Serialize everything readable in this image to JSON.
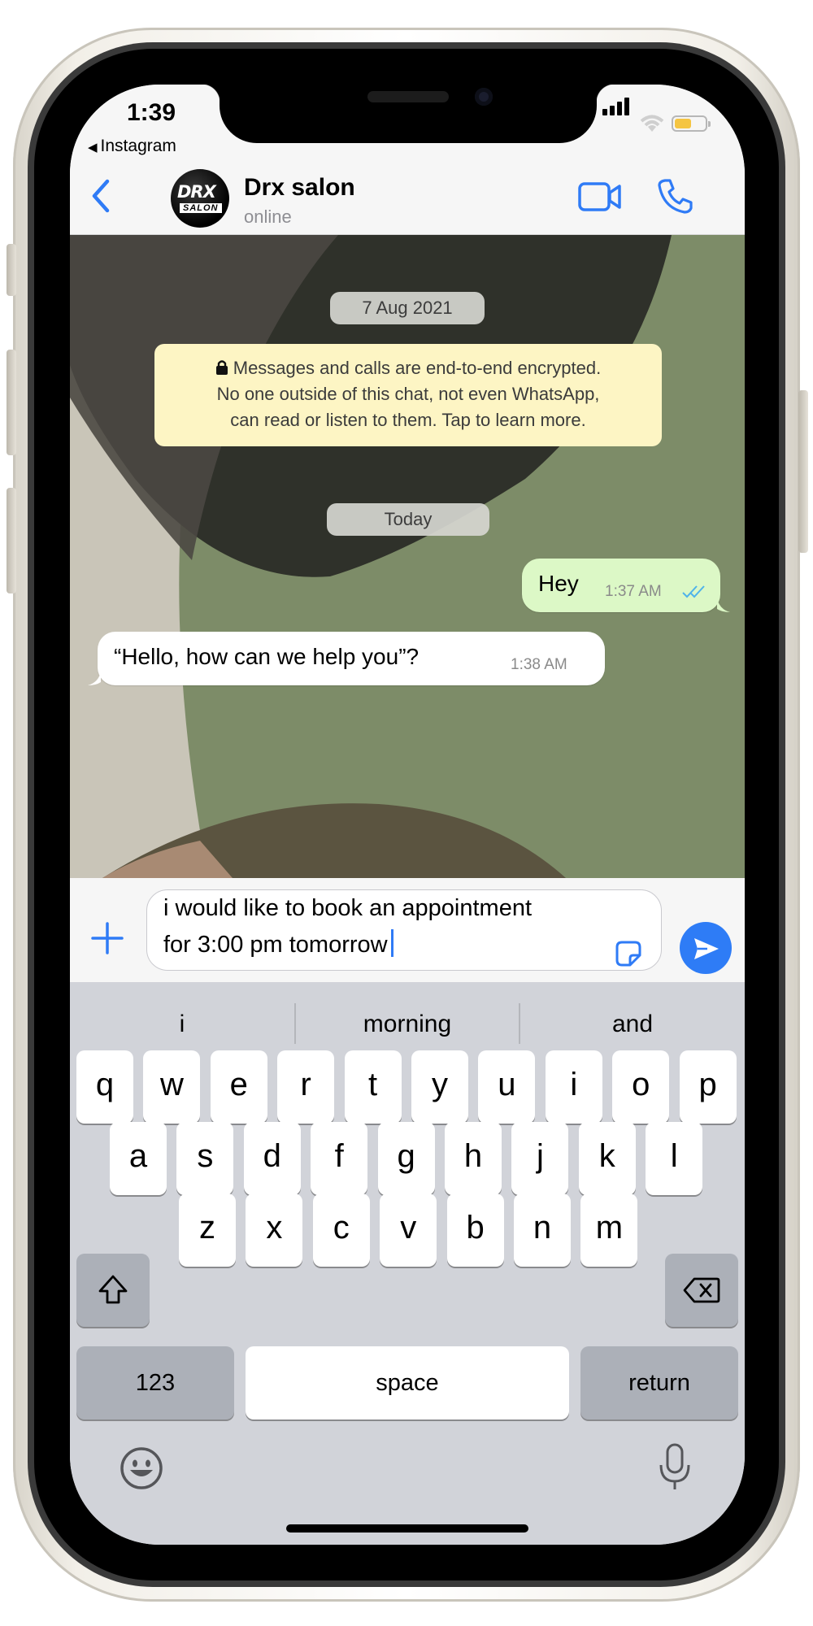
{
  "status_bar": {
    "time": "1:39",
    "back_app": "Instagram",
    "back_arrow": "◀"
  },
  "header": {
    "back_icon": "chevron-left-icon",
    "contact_name": "Drx salon",
    "contact_status": "online",
    "avatar_text_top": "DRX",
    "avatar_text_bottom": "SALON",
    "video_icon": "video-camera-icon",
    "call_icon": "phone-icon",
    "accent_color": "#2f7bf6"
  },
  "chat": {
    "date_pill_1": "7 Aug 2021",
    "encryption_notice": {
      "line1": "Messages and calls are end-to-end encrypted.",
      "line2": "No one outside of this chat, not even WhatsApp,",
      "line3": "can read or listen to them. Tap to learn more."
    },
    "date_pill_2": "Today",
    "messages": [
      {
        "direction": "outgoing",
        "text": "Hey",
        "time": "1:37 AM",
        "status": "read"
      },
      {
        "direction": "incoming",
        "text": "“Hello, how can we help you”?",
        "time": "1:38 AM"
      }
    ],
    "outgoing_bubble_color": "#dcf8c6",
    "encryption_box_color": "#fdf5c4"
  },
  "composer": {
    "line1": "i would like to book an appointment",
    "line2": "for 3:00 pm tomorrow",
    "plus_icon": "plus-icon",
    "sticker_icon": "sticker-icon",
    "send_icon": "send-icon"
  },
  "keyboard": {
    "suggestions": [
      "i",
      "morning",
      "and"
    ],
    "row1": [
      "q",
      "w",
      "e",
      "r",
      "t",
      "y",
      "u",
      "i",
      "o",
      "p"
    ],
    "row2": [
      "a",
      "s",
      "d",
      "f",
      "g",
      "h",
      "j",
      "k",
      "l"
    ],
    "row3": [
      "z",
      "x",
      "c",
      "v",
      "b",
      "n",
      "m"
    ],
    "numbers_key": "123",
    "space_key": "space",
    "return_key": "return",
    "shift_icon": "shift-icon",
    "delete_icon": "backspace-icon",
    "emoji_icon": "emoji-icon",
    "mic_icon": "microphone-icon"
  }
}
